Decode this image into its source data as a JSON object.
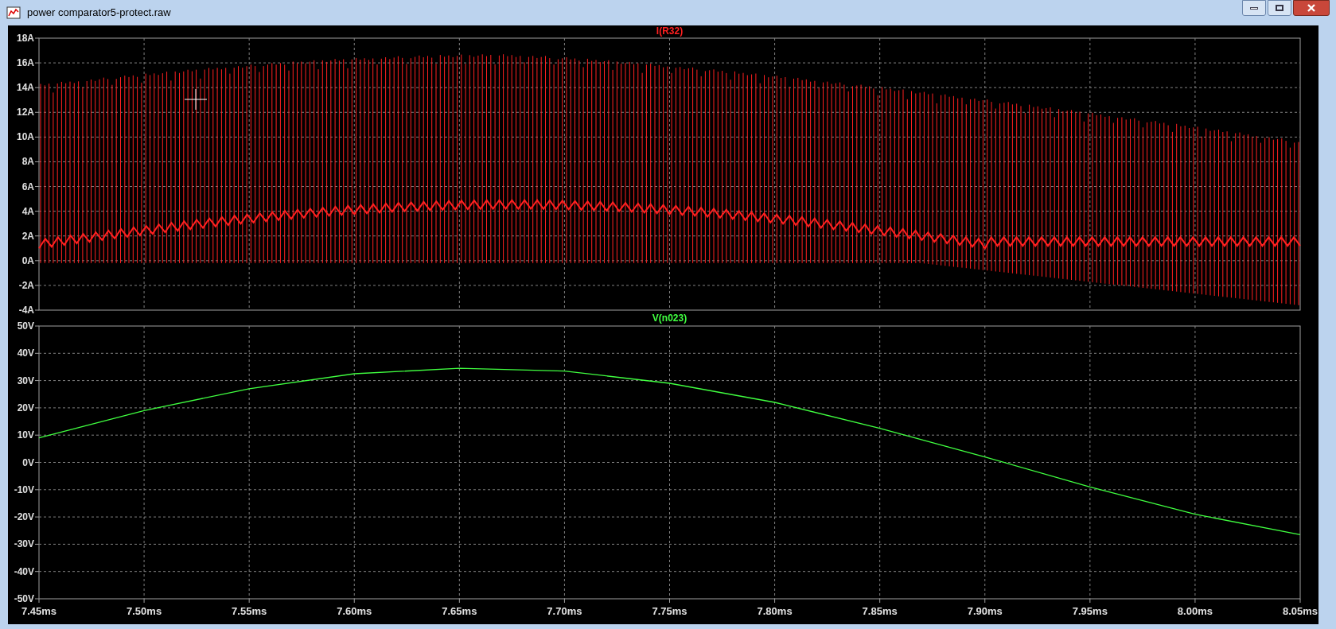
{
  "window": {
    "title": "power comparator5-protect.raw"
  },
  "current_plot": {
    "trace": {
      "name": "I(R32)",
      "color": "#ff2020"
    },
    "y_tick_labels": [
      "18A",
      "16A",
      "14A",
      "12A",
      "10A",
      "8A",
      "6A",
      "4A",
      "2A",
      "0A",
      "-2A",
      "-4A"
    ]
  },
  "voltage_plot": {
    "chart_data": {
      "type": "line",
      "x": [
        7.45,
        7.5,
        7.55,
        7.6,
        7.65,
        7.7,
        7.75,
        7.8,
        7.85,
        7.9,
        7.95,
        8.0,
        8.05
      ],
      "series": [
        {
          "name": "V(n023)",
          "color": "#40ff40",
          "values": [
            9,
            19,
            27,
            32.5,
            34.5,
            33.5,
            29,
            22,
            12.5,
            2,
            -9,
            -19,
            -26.5
          ]
        }
      ],
      "xlim": [
        7.45,
        8.05
      ],
      "ylim": [
        -50,
        50
      ],
      "grid": true,
      "xticks": [
        {
          "value": 7.45,
          "label": "7.45ms"
        },
        {
          "value": 7.5,
          "label": "7.50ms"
        },
        {
          "value": 7.55,
          "label": "7.55ms"
        },
        {
          "value": 7.6,
          "label": "7.60ms"
        },
        {
          "value": 7.65,
          "label": "7.65ms"
        },
        {
          "value": 7.7,
          "label": "7.70ms"
        },
        {
          "value": 7.75,
          "label": "7.75ms"
        },
        {
          "value": 7.8,
          "label": "7.80ms"
        },
        {
          "value": 7.85,
          "label": "7.85ms"
        },
        {
          "value": 7.9,
          "label": "7.90ms"
        },
        {
          "value": 7.95,
          "label": "7.95ms"
        },
        {
          "value": 8.0,
          "label": "8.00ms"
        },
        {
          "value": 8.05,
          "label": "8.05ms"
        }
      ],
      "yticks": [
        {
          "value": 50,
          "label": "50V"
        },
        {
          "value": 40,
          "label": "40V"
        },
        {
          "value": 30,
          "label": "30V"
        },
        {
          "value": 20,
          "label": "20V"
        },
        {
          "value": 10,
          "label": "10V"
        },
        {
          "value": 0,
          "label": "0V"
        },
        {
          "value": -10,
          "label": "-10V"
        },
        {
          "value": -20,
          "label": "-20V"
        },
        {
          "value": -30,
          "label": "-30V"
        },
        {
          "value": -40,
          "label": "-40V"
        },
        {
          "value": -50,
          "label": "-50V"
        }
      ]
    }
  }
}
